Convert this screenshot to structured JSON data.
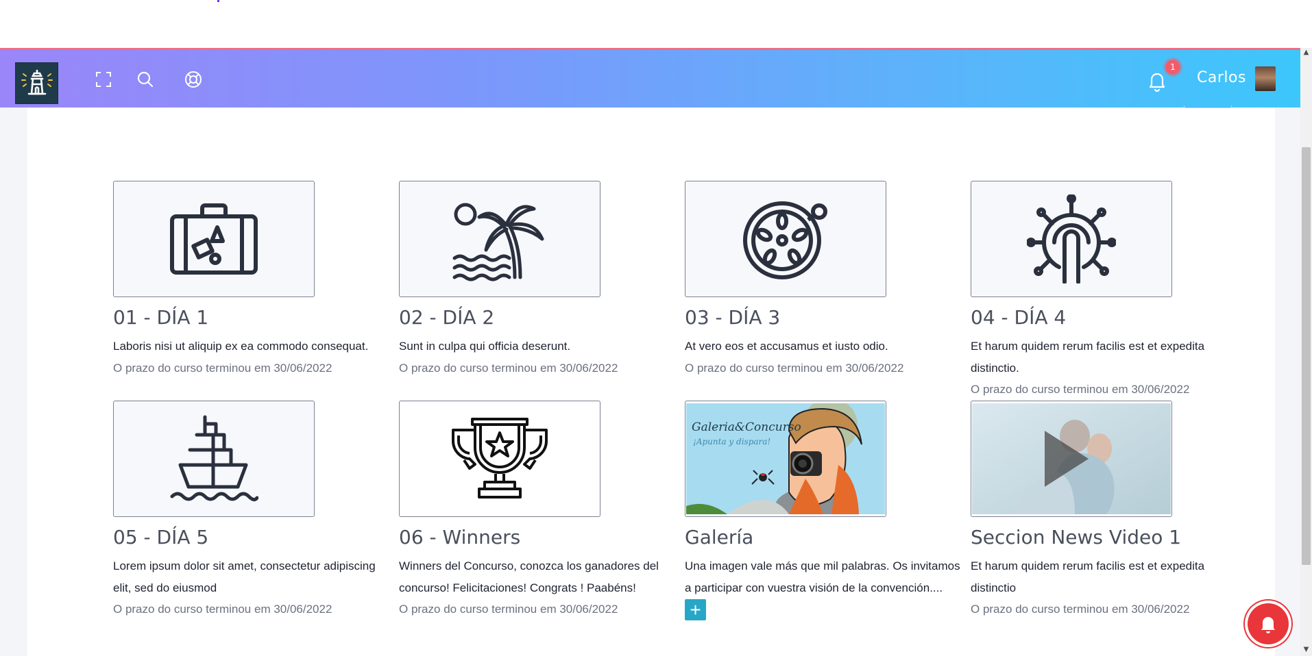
{
  "navbar": {
    "user_name": "Carlos",
    "notification_count": "1",
    "accent_colors": {
      "gradient_start": "#9a86f9",
      "gradient_end": "#3cc7fb",
      "top_border": "#f36b7f",
      "badge": "#f25c6a"
    },
    "icons": [
      "lighthouse-logo-icon",
      "fullscreen-icon",
      "search-icon",
      "lifebuoy-icon",
      "bell-icon"
    ]
  },
  "cards": [
    {
      "title": "01 - DÍA 1",
      "description": "Laboris nisi ut aliquip ex ea commodo consequat.",
      "deadline": "O prazo do curso terminou em 30/06/2022",
      "icon": "suitcase-icon"
    },
    {
      "title": "02 - DÍA 2",
      "description": "Sunt in culpa qui officia deserunt.",
      "deadline": "O prazo do curso terminou em 30/06/2022",
      "icon": "palm-beach-icon"
    },
    {
      "title": "03 - DÍA 3",
      "description": "At vero eos et accusamus et iusto odio.",
      "deadline": "O prazo do curso terminou em 30/06/2022",
      "icon": "paella-icon"
    },
    {
      "title": "04 - DÍA 4",
      "description": "Et harum quidem rerum facilis est et expedita distinctio.",
      "deadline": "O prazo do curso terminou em 30/06/2022",
      "icon": "ship-wheel-icon"
    },
    {
      "title": "05 - DÍA 5",
      "description": "Lorem ipsum dolor sit amet, consectetur adipiscing elit, sed do eiusmod",
      "deadline": "O prazo do curso terminou em 30/06/2022",
      "icon": "cruise-ship-icon"
    },
    {
      "title": "06 - Winners",
      "description": "Winners del Concurso, conozca los ganadores del concurso! Felicitaciones! Congrats ! Paabéns!",
      "deadline": "O prazo do curso terminou em 30/06/2022",
      "icon": "trophy-icon"
    },
    {
      "title": "Galería",
      "description": "Una imagen vale más que mil palabras. Os invitamos a participar con vuestra visión de la convención....",
      "deadline": "",
      "icon": "gallery-contest-image",
      "image_text_1": "Galeria&Concurso",
      "image_text_2": "¡Apunta y dispara!"
    },
    {
      "title": "Seccion News Video 1",
      "description": "Et harum quidem rerum facilis est et expedita distinctio",
      "deadline": "O prazo do curso terminou em 30/06/2022",
      "icon": "video-play-icon"
    }
  ],
  "more_button": {
    "label": "+"
  },
  "chat_fab": {
    "icon": "bell-icon"
  }
}
